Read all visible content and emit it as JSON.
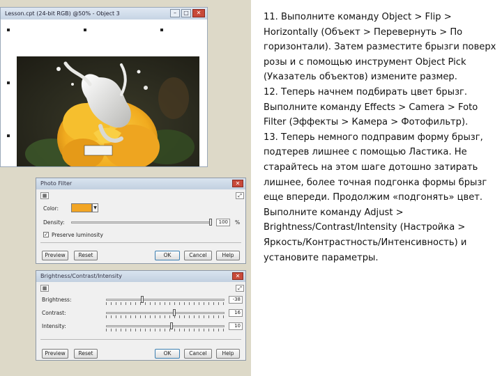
{
  "image_window": {
    "title": "Lesson.cpt (24-bit RGB) @50% - Object 3",
    "minimize": "–",
    "maximize": "□",
    "close": "✕"
  },
  "photo_filter": {
    "title": "Photo Filter",
    "close": "✕",
    "color_label": "Color:",
    "color_value": "#f2a524",
    "density_label": "Density:",
    "density_value": "100",
    "density_unit": "%",
    "preserve_label": "Preserve luminosity",
    "preserve_checked": "✓",
    "buttons": {
      "preview": "Preview",
      "reset": "Reset",
      "ok": "OK",
      "cancel": "Cancel",
      "help": "Help"
    }
  },
  "bci": {
    "title": "Brightness/Contrast/Intensity",
    "close": "✕",
    "brightness_label": "Brightness:",
    "brightness_value": "-38",
    "contrast_label": "Contrast:",
    "contrast_value": "16",
    "intensity_label": "Intensity:",
    "intensity_value": "10",
    "buttons": {
      "preview": "Preview",
      "reset": "Reset",
      "ok": "OK",
      "cancel": "Cancel",
      "help": "Help"
    }
  },
  "text": {
    "p1": "11. Выполните команду Object > Flip > Horizontally (Объект > Перевернуть > По горизонтали). Затем разместите брызги поверх розы и с помощью инструмент Object Pick (Указатель объектов) измените размер.",
    "p2": "12. Теперь начнем подбирать цвет брызг. Выполните команду Effects > Camera > Foto Filter (Эффекты > Камера > Фотофильтр).",
    "p3": "13. Теперь немного подправим форму брызг, подтерев лишнее с помощью Ластика. Не старайтесь на этом шаге дотошно затирать лишнее, более точная подгонка формы брызг еще впереди. Продолжим «подгонять» цвет. Выполните команду Adjust > Brightness/Contrast/Intensity (Настройка > Яркость/Контрастность/Интенсивность) и установите параметры."
  }
}
